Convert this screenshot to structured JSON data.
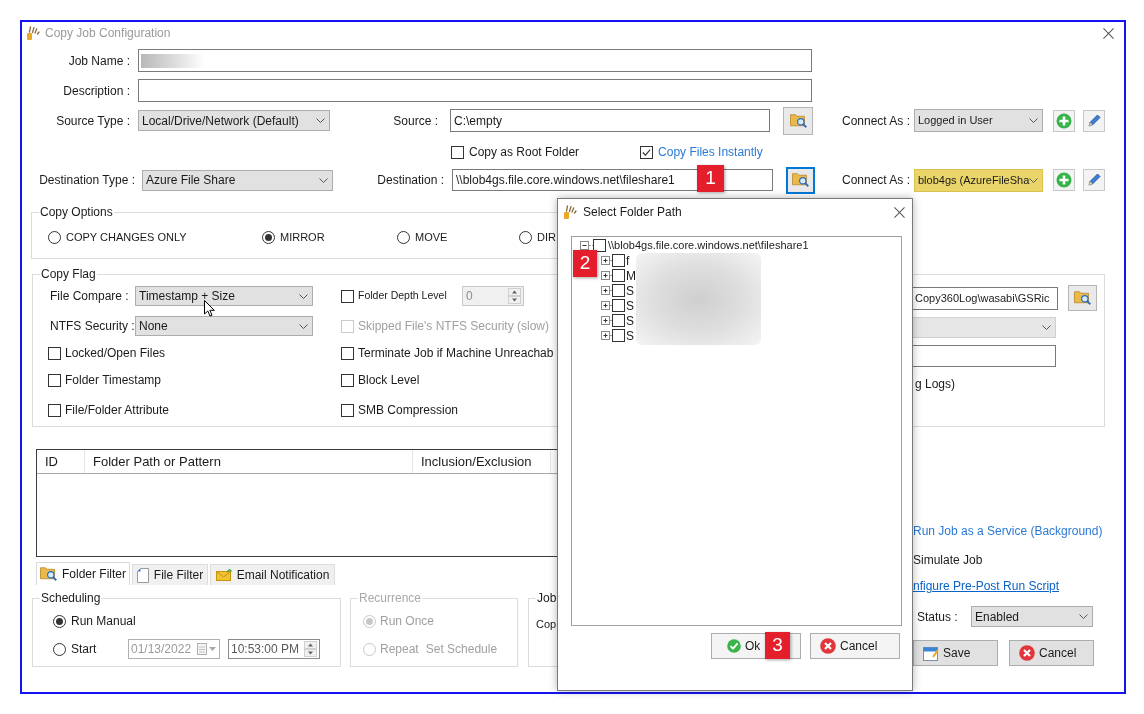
{
  "window": {
    "title": "Copy Job Configuration"
  },
  "job_name": {
    "label": "Job Name :",
    "blurred": true
  },
  "description": {
    "label": "Description :"
  },
  "source": {
    "type_label": "Source Type :",
    "type_value": "Local/Drive/Network (Default)",
    "label": "Source :",
    "value": "C:\\empty",
    "browse_focused": false,
    "connect_label": "Connect As :",
    "connect_value": "Logged in User",
    "connect_highlighted": false
  },
  "source_options": [
    {
      "label": "Copy as Root Folder",
      "checked": false,
      "kind": "plain"
    },
    {
      "label": "Copy Files Instantly",
      "checked": true,
      "kind": "link"
    }
  ],
  "destination": {
    "type_label": "Destination Type :",
    "type_value": "Azure File Share",
    "label": "Destination :",
    "value": "\\\\blob4gs.file.core.windows.net\\fileshare1",
    "browse_focused": true,
    "connect_label": "Connect As :",
    "connect_value": "blob4gs (AzureFileSha",
    "connect_highlighted": true
  },
  "copy_options": {
    "title": "Copy Options",
    "options": [
      {
        "label": "COPY CHANGES ONLY",
        "selected": false
      },
      {
        "label": "MIRROR",
        "selected": true
      },
      {
        "label": "MOVE",
        "selected": false
      },
      {
        "label": "DIR",
        "selected": false
      }
    ]
  },
  "copy_flag": {
    "title": "Copy Flag",
    "file_compare": {
      "label": "File Compare :",
      "value": "Timestamp + Size"
    },
    "ntfs_security": {
      "label": "NTFS Security :",
      "value": "None"
    },
    "left_checks": [
      {
        "label": "Locked/Open Files",
        "checked": false
      },
      {
        "label": "Folder Timestamp",
        "checked": false
      },
      {
        "label": "File/Folder Attribute",
        "checked": false
      }
    ],
    "right_checks": [
      {
        "kind": "spinner",
        "label": "Folder Depth Level",
        "checked": false,
        "disabled": false,
        "value": "0",
        "value_disabled": true
      },
      {
        "kind": "plain",
        "label": "Skipped File's NTFS Security (slow)",
        "checked": false,
        "disabled": true
      },
      {
        "kind": "plain",
        "label": "Terminate Job if Machine Unreachab",
        "checked": false,
        "disabled": false
      },
      {
        "kind": "plain",
        "label": "Block Level",
        "checked": false,
        "disabled": false
      },
      {
        "kind": "plain",
        "label": "SMB Compression",
        "checked": false,
        "disabled": false
      }
    ],
    "log_path": "Copy360Log\\wasabi\\GSRic",
    "log_level_disabled": true,
    "log_note": "g Logs)"
  },
  "filter_table": {
    "columns": [
      "ID",
      "Folder Path or Pattern",
      "Inclusion/Exclusion"
    ]
  },
  "tabs": [
    {
      "label": "Folder Filter",
      "selected": true
    },
    {
      "label": "File Filter",
      "selected": false
    },
    {
      "label": "Email Notification",
      "selected": false
    }
  ],
  "scheduling": {
    "title": "Scheduling",
    "options": [
      {
        "label": "Run Manual",
        "selected": true
      },
      {
        "label": "Start",
        "selected": false
      }
    ],
    "fields_disabled": true,
    "date": "01/13/2022",
    "time": "10:53:00 PM"
  },
  "recurrence": {
    "title": "Recurrence",
    "disabled": true,
    "options": [
      {
        "label": "Run Once",
        "selected": true
      },
      {
        "label": "Repeat",
        "selected": false
      }
    ],
    "schedule_label": "Set Schedule"
  },
  "job": {
    "title": "Job",
    "text": "Cop"
  },
  "options_panel": {
    "service_link": "Run Job as a Service (Background)",
    "simulate": "Simulate Job",
    "script_link": "nfigure Pre-Post Run Script",
    "status_label": "Status :",
    "status_value": "Enabled"
  },
  "buttons": [
    "Save",
    "Cancel"
  ],
  "dialog": {
    "title": "Select Folder Path",
    "names_blurred": true,
    "tree": {
      "label": "\\\\blob4gs.file.core.windows.net\\fileshare1",
      "checked": false,
      "expanded": true,
      "children": [
        {
          "label": "f",
          "checked": false,
          "expanded": false
        },
        {
          "label": "M",
          "checked": false,
          "expanded": false
        },
        {
          "label": "S",
          "checked": false,
          "expanded": false
        },
        {
          "label": "S",
          "checked": false,
          "expanded": false
        },
        {
          "label": "S",
          "checked": false,
          "expanded": false
        },
        {
          "label": "S",
          "checked": false,
          "expanded": false
        }
      ]
    },
    "buttons": [
      "Ok",
      "Cancel"
    ]
  },
  "annotations": [
    "1",
    "2",
    "3"
  ]
}
